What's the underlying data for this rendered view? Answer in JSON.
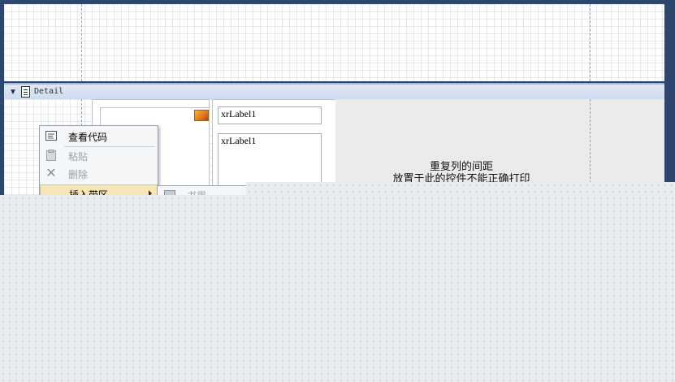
{
  "band": {
    "title": "Detail"
  },
  "labels": [
    "xrLabel1",
    "xrLabel1"
  ],
  "note": {
    "line1": "重复列的间距",
    "line2": "放置于此的控件不能正确打印"
  },
  "context_menu": {
    "items": [
      {
        "label": "查看代码",
        "icon": "view-code-icon",
        "enabled": true
      },
      {
        "label": "粘贴",
        "icon": "paste-icon",
        "enabled": false
      },
      {
        "label": "删除",
        "icon": "delete-icon",
        "enabled": false
      },
      {
        "label": "插入带区",
        "icon": "",
        "enabled": true,
        "has_submenu": true
      }
    ]
  },
  "submenu": {
    "first_item_label": "书眉"
  },
  "colors": {
    "frame": "#2e466e",
    "band_header": "#dfe8f5",
    "menu_highlight": "#f7e7b6"
  }
}
